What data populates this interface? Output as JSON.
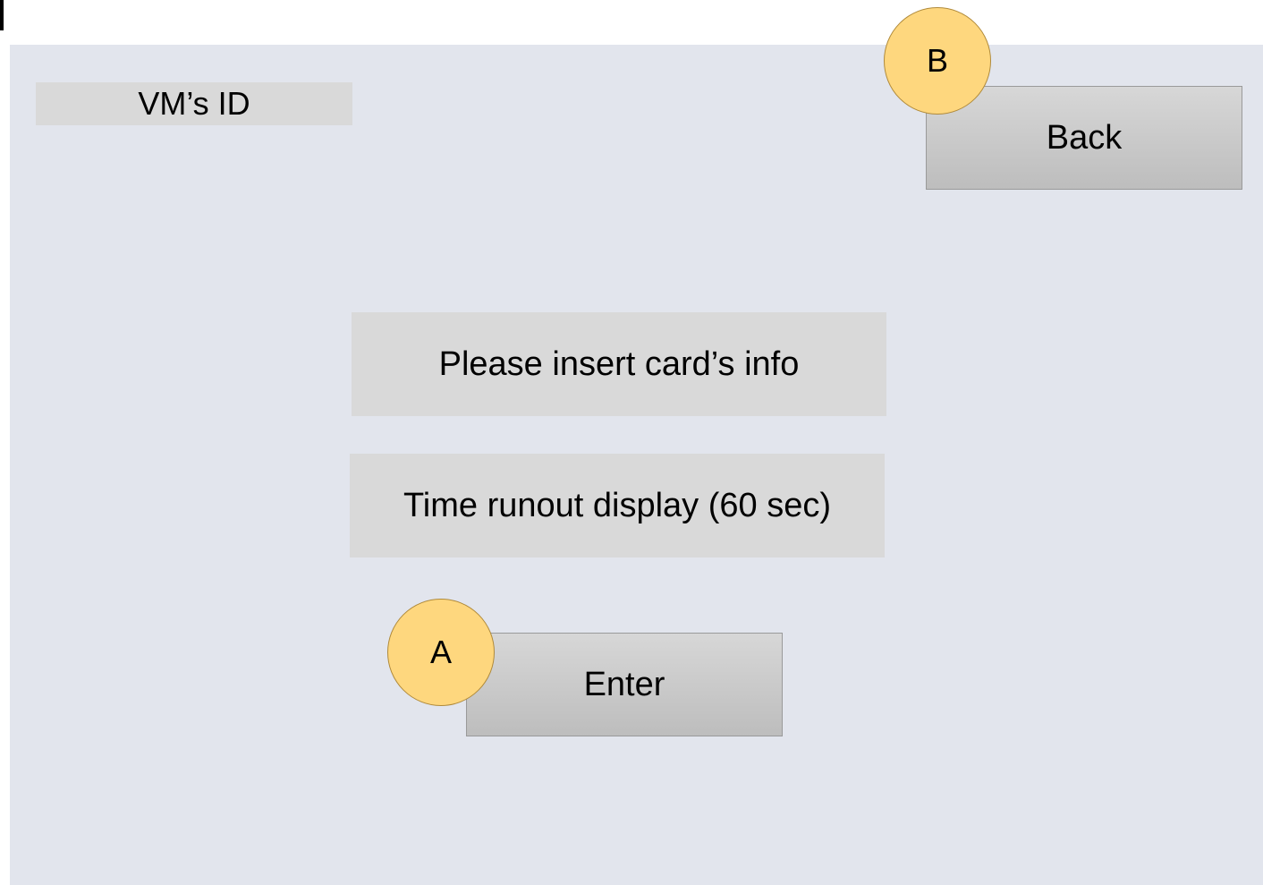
{
  "screen": {
    "vm_id_label": "VM’s ID",
    "message": "Please insert card’s info",
    "timer": "Time runout display (60 sec)",
    "back_button": "Back",
    "enter_button": "Enter",
    "marker_a": "A",
    "marker_b": "B"
  },
  "colors": {
    "screen_background": "#e2e5ed",
    "label_background": "#d9d9d9",
    "button_background": "#c9c9c9",
    "marker_fill": "#fed77e"
  }
}
